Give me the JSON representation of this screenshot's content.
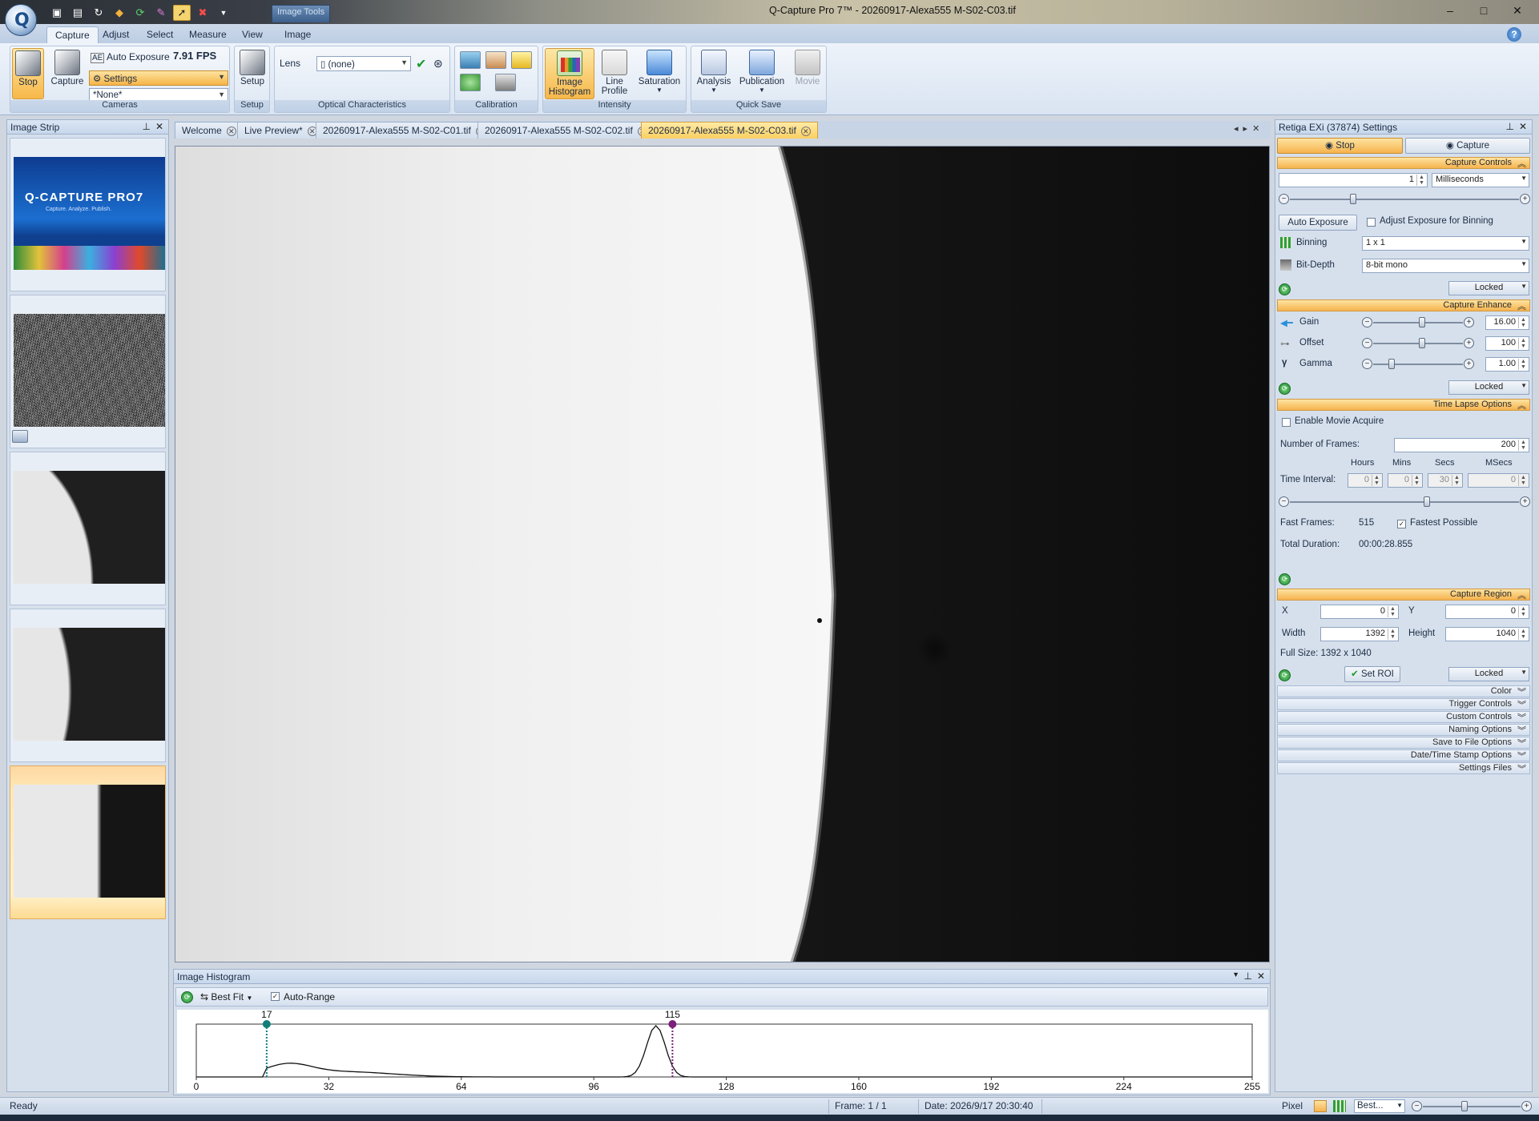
{
  "window": {
    "title": "Q-Capture Pro 7™ - 20260917-Alexa555 M-S02-C03.tif",
    "image_tools_label": "Image Tools",
    "controls": [
      "–",
      "□",
      "✕"
    ]
  },
  "ribbon": {
    "tabs": [
      "Capture",
      "Adjust",
      "Select",
      "Measure",
      "View",
      "Image"
    ],
    "active_tab": "Capture",
    "cameras": {
      "stop_label": "Stop",
      "capture_label": "Capture",
      "auto_exposure_label": "Auto Exposure",
      "fps": "7.91 FPS",
      "settings_label": "Settings",
      "preset_value": "*None*",
      "group_label": "Cameras"
    },
    "setup": {
      "button_label": "Setup",
      "group_label": "Setup"
    },
    "optical": {
      "lens_label": "Lens",
      "lens_value": "(none)",
      "group_label": "Optical Characteristics"
    },
    "calibration": {
      "group_label": "Calibration"
    },
    "intensity": {
      "histogram_label_1": "Image",
      "histogram_label_2": "Histogram",
      "line_label_1": "Line",
      "line_label_2": "Profile",
      "saturation_label": "Saturation",
      "group_label": "Intensity"
    },
    "quick_save": {
      "analysis_label": "Analysis",
      "publication_label": "Publication",
      "movie_label": "Movie",
      "group_label": "Quick Save"
    }
  },
  "image_strip": {
    "title": "Image Strip",
    "splash": {
      "logo_text": "Q-CAPTURE PRO7",
      "tagline": "Capture. Analyze. Publish."
    }
  },
  "doc_tabs": [
    {
      "label": "Welcome",
      "active": false
    },
    {
      "label": "Live Preview*",
      "active": false
    },
    {
      "label": "20260917-Alexa555 M-S02-C01.tif",
      "active": false
    },
    {
      "label": "20260917-Alexa555 M-S02-C02.tif",
      "active": false
    },
    {
      "label": "20260917-Alexa555 M-S02-C03.tif",
      "active": true
    }
  ],
  "histogram": {
    "title": "Image Histogram",
    "fit_label": "Best Fit",
    "auto_range_label": "Auto-Range",
    "auto_range_checked": true,
    "low_marker": 17,
    "high_marker": 115,
    "low_color": "#0f7f7a",
    "high_color": "#7a1f7a",
    "ticks": [
      "0",
      "32",
      "64",
      "96",
      "128",
      "160",
      "192",
      "224",
      "255"
    ]
  },
  "settings": {
    "title": "Retiga EXi (37874) Settings",
    "stop_label": "Stop",
    "capture_label": "Capture",
    "capture_controls": {
      "header": "Capture Controls",
      "exposure_value": "1",
      "exposure_unit": "Milliseconds",
      "exposure_slider": 0.27,
      "auto_exposure_label": "Auto Exposure",
      "adjust_binning_label": "Adjust Exposure for Binning",
      "binning_label": "Binning",
      "binning_value": "1 x 1",
      "bitdepth_label": "Bit-Depth",
      "bitdepth_value": "8-bit mono",
      "locked_label": "Locked"
    },
    "capture_enhance": {
      "header": "Capture Enhance",
      "gain_label": "Gain",
      "gain_value": "16.00",
      "gain_slider": 0.55,
      "offset_label": "Offset",
      "offset_value": "100",
      "offset_slider": 0.55,
      "gamma_label": "Gamma",
      "gamma_value": "1.00",
      "gamma_slider": 0.18,
      "locked_label": "Locked"
    },
    "time_lapse": {
      "header": "Time Lapse Options",
      "enable_movie_label": "Enable Movie Acquire",
      "frames_label": "Number of Frames:",
      "frames_value": "200",
      "hours_label": "Hours",
      "mins_label": "Mins",
      "secs_label": "Secs",
      "msecs_label": "MSecs",
      "interval_label": "Time Interval:",
      "hours_value": "0",
      "mins_value": "0",
      "secs_value": "30",
      "msecs_value": "0",
      "interval_slider": 0.6,
      "fast_frames_label": "Fast Frames:",
      "fast_frames_value": "515",
      "fastest_label": "Fastest Possible",
      "total_duration_label": "Total Duration:",
      "total_duration_value": "00:00:28.855"
    },
    "capture_region": {
      "header": "Capture Region",
      "x_label": "X",
      "x_value": "0",
      "y_label": "Y",
      "y_value": "0",
      "width_label": "Width",
      "width_value": "1392",
      "height_label": "Height",
      "height_value": "1040",
      "full_size": "Full Size: 1392 x 1040",
      "set_roi_label": "Set ROI",
      "locked_label": "Locked"
    },
    "collapsed_sections": [
      "Color",
      "Trigger Controls",
      "Custom Controls",
      "Naming Options",
      "Save to File Options",
      "Date/Time Stamp Options",
      "Settings Files"
    ]
  },
  "status": {
    "ready": "Ready",
    "frame": "Frame: 1 / 1",
    "date": "Date: 2026/9/17 20:30:40",
    "pixel": "Pixel",
    "zoom": "Best..."
  }
}
